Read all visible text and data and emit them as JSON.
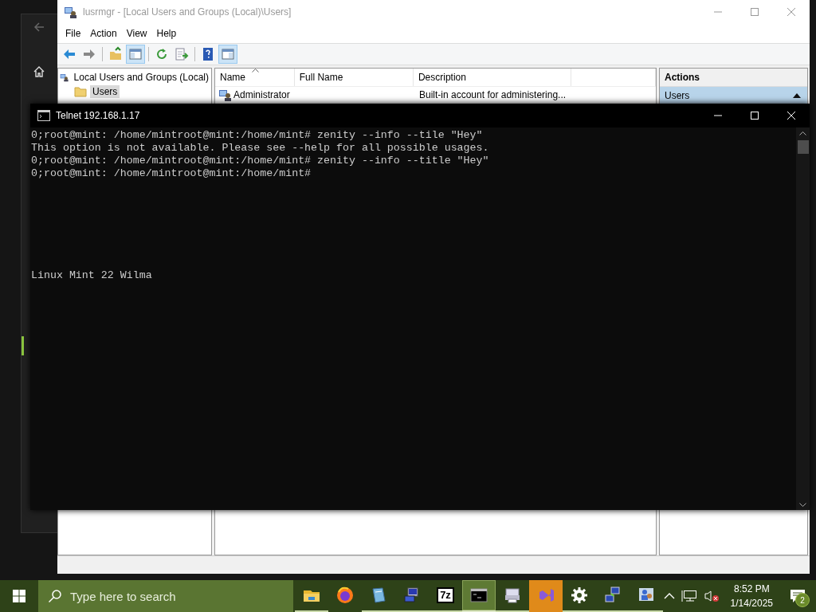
{
  "lusrmgr": {
    "title": "lusrmgr - [Local Users and Groups (Local)\\Users]",
    "menu": [
      "File",
      "Action",
      "View",
      "Help"
    ],
    "toolbar": [
      {
        "kind": "back",
        "pressed": false
      },
      {
        "kind": "forward",
        "pressed": false
      },
      {
        "kind": "separator"
      },
      {
        "kind": "up-folder",
        "pressed": false
      },
      {
        "kind": "console-tree",
        "pressed": true
      },
      {
        "kind": "separator"
      },
      {
        "kind": "refresh",
        "pressed": false
      },
      {
        "kind": "export",
        "pressed": false
      },
      {
        "kind": "separator"
      },
      {
        "kind": "help",
        "pressed": false
      },
      {
        "kind": "action-pane",
        "pressed": true
      }
    ],
    "tree": [
      {
        "label": "Local Users and Groups (Local)",
        "selected": false,
        "children": [
          {
            "label": "Users",
            "selected": true
          }
        ]
      }
    ],
    "list": {
      "columns": [
        {
          "label": "Name",
          "sorted": true
        },
        {
          "label": "Full Name",
          "sorted": false
        },
        {
          "label": "Description",
          "sorted": false
        }
      ],
      "rows": [
        {
          "name": "Administrator",
          "description": "Built-in account for administering..."
        }
      ]
    },
    "actions": {
      "title": "Actions",
      "sections": [
        {
          "label": "Users",
          "expanded": true
        }
      ]
    }
  },
  "telnet": {
    "title": "Telnet 192.168.1.17",
    "lines": [
      "0;root@mint: /home/mintroot@mint:/home/mint# zenity --info --tile \"Hey\"",
      "This option is not available. Please see --help for all possible usages.",
      "0;root@mint: /home/mintroot@mint:/home/mint# zenity --info --title \"Hey\"",
      "0;root@mint: /home/mintroot@mint:/home/mint#"
    ],
    "banner": "Linux Mint 22 Wilma"
  },
  "taskbar": {
    "search_placeholder": "Type here to search",
    "apps": [
      {
        "kind": "folder",
        "running": true,
        "selected": false,
        "flashing": false
      },
      {
        "kind": "firefox",
        "running": false,
        "selected": false,
        "flashing": false
      },
      {
        "kind": "notebook",
        "running": true,
        "selected": false,
        "flashing": false
      },
      {
        "kind": "computer",
        "running": true,
        "selected": false,
        "flashing": false
      },
      {
        "kind": "archive",
        "label": "7z",
        "running": true,
        "selected": false,
        "flashing": false
      },
      {
        "kind": "console",
        "running": true,
        "selected": true,
        "flashing": false
      },
      {
        "kind": "printer",
        "running": true,
        "selected": false,
        "flashing": false
      },
      {
        "kind": "studio",
        "running": false,
        "selected": false,
        "flashing": true
      },
      {
        "kind": "gear",
        "running": true,
        "selected": false,
        "flashing": false
      },
      {
        "kind": "network",
        "running": true,
        "selected": false,
        "flashing": false
      },
      {
        "kind": "users",
        "running": true,
        "selected": false,
        "flashing": false
      }
    ],
    "volume_muted": true,
    "clock": {
      "time": "8:52 PM",
      "date": "1/14/2025"
    },
    "notifications": "2"
  }
}
